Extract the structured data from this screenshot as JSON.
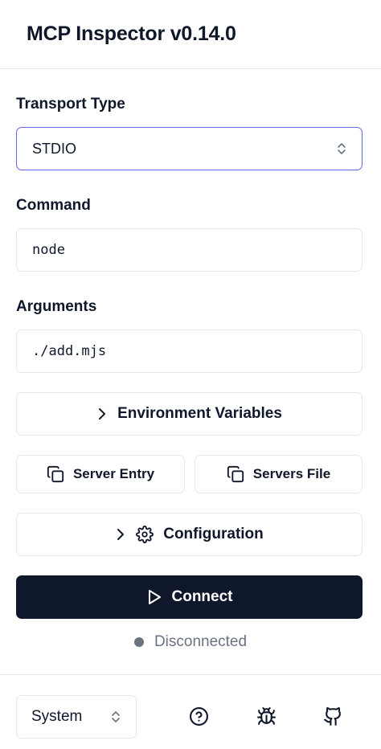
{
  "app": {
    "title": "MCP Inspector v0.14.0"
  },
  "transport": {
    "label": "Transport Type",
    "value": "STDIO"
  },
  "command": {
    "label": "Command",
    "value": "node"
  },
  "arguments": {
    "label": "Arguments",
    "value": "./add.mjs"
  },
  "buttons": {
    "env_vars": "Environment Variables",
    "server_entry": "Server Entry",
    "servers_file": "Servers File",
    "configuration": "Configuration",
    "connect": "Connect"
  },
  "status": {
    "text": "Disconnected",
    "color": "#6b7280"
  },
  "footer": {
    "theme": "System",
    "icons": [
      "help-icon",
      "bug-icon",
      "github-icon"
    ]
  },
  "colors": {
    "primary": "#0f172a",
    "accent_border": "#6366f1",
    "border": "#e2e8f0"
  }
}
